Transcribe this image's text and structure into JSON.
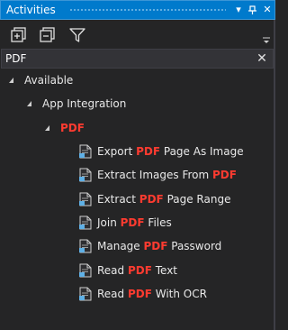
{
  "panel": {
    "title": "Activities",
    "pin_glyph": "⊣",
    "close_glyph": "✕",
    "menu_glyph": "▾"
  },
  "toolbar": {
    "expand_all": "expand-all-icon",
    "collapse_all": "collapse-all-icon",
    "filter": "filter-icon"
  },
  "search": {
    "value": "PDF",
    "clear_glyph": "✕"
  },
  "tree": {
    "available": "Available",
    "app_integration": "App Integration",
    "pdf": "PDF",
    "items": [
      {
        "pre": "Export ",
        "hl": "PDF",
        "post": " Page As Image"
      },
      {
        "pre": "Extract Images From ",
        "hl": "PDF",
        "post": ""
      },
      {
        "pre": "Extract ",
        "hl": "PDF",
        "post": " Page Range"
      },
      {
        "pre": "Join ",
        "hl": "PDF",
        "post": " Files"
      },
      {
        "pre": "Manage ",
        "hl": "PDF",
        "post": " Password"
      },
      {
        "pre": "Read ",
        "hl": "PDF",
        "post": " Text"
      },
      {
        "pre": "Read ",
        "hl": "PDF",
        "post": " With OCR"
      }
    ]
  },
  "colors": {
    "accent": "#007acc",
    "highlight": "#ff3b30",
    "background": "#252526"
  }
}
